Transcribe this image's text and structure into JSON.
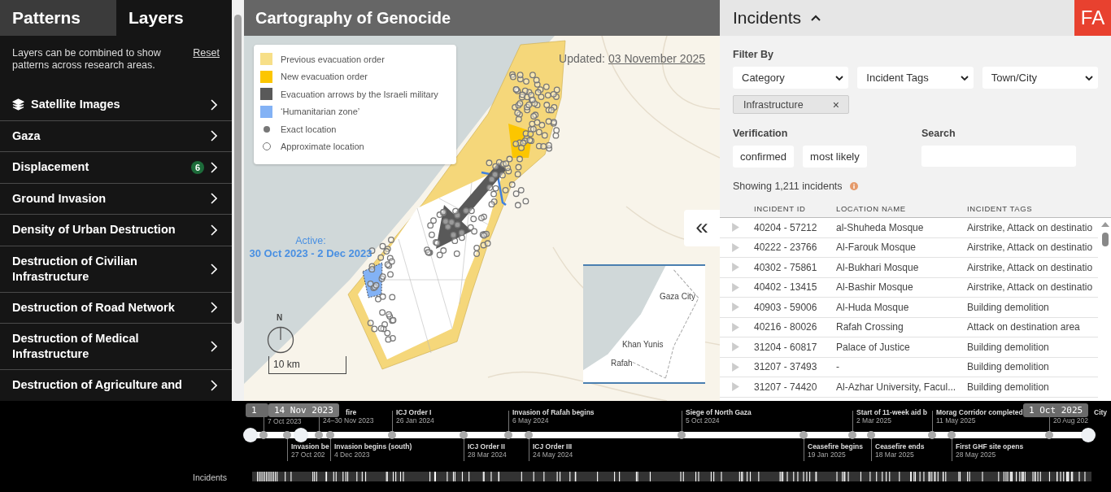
{
  "sidebar": {
    "tabs": [
      {
        "label": "Patterns",
        "selected": false
      },
      {
        "label": "Layers",
        "selected": true
      }
    ],
    "intro": "Layers can be combined to show patterns across research areas.",
    "reset": "Reset",
    "items": [
      {
        "label": "Satellite Images",
        "kind": "layers"
      },
      {
        "label": "Gaza",
        "kind": "plain"
      },
      {
        "label": "Displacement",
        "kind": "plain",
        "badge": "6"
      },
      {
        "label": "Ground Invasion",
        "kind": "plain"
      },
      {
        "label": "Density of Urban Destruction",
        "kind": "plain"
      },
      {
        "label": "Destruction of Civilian Infrastructure",
        "kind": "plain"
      },
      {
        "label": "Destruction of Road Network",
        "kind": "plain"
      },
      {
        "label": "Destruction of Medical Infrastructure",
        "kind": "plain"
      },
      {
        "label": "Destruction of Agriculture and",
        "kind": "plain"
      }
    ]
  },
  "map": {
    "title": "Cartography of Genocide",
    "legend": [
      {
        "label": "Previous evacuation order",
        "kind": "swatch",
        "color": "#f7df88"
      },
      {
        "label": "New evacuation order",
        "kind": "swatch",
        "color": "#fcc600"
      },
      {
        "label": "Evacuation arrows by the Israeli military",
        "kind": "swatch",
        "color": "#595959"
      },
      {
        "label": "‘Humanitarian zone’",
        "kind": "swatch",
        "color": "#83b2f5"
      },
      {
        "label": "Exact location",
        "kind": "dot",
        "color": "#777777"
      },
      {
        "label": "Approximate location",
        "kind": "ring",
        "color": "#777777"
      }
    ],
    "updated_label": "Updated:",
    "updated_date": "03 November 2025",
    "active_label": "Active:",
    "active_range": "30 Oct 2023 - 2 Dec 2023",
    "compass": "N",
    "scale": "10 km",
    "inset_places": [
      "Gaza City",
      "Khan Yunis",
      "Rafah"
    ],
    "collapse": "«"
  },
  "incidents": {
    "title": "Incidents",
    "expanded": true,
    "logo": "FA",
    "filter_label": "Filter By",
    "selects": [
      "Category",
      "Incident Tags",
      "Town/City"
    ],
    "chips": [
      "Infrastructure"
    ],
    "chip_remove": "×",
    "verification_label": "Verification",
    "verification": [
      "confirmed",
      "most likely"
    ],
    "search_label": "Search",
    "count": "Showing 1,211 incidents",
    "columns": [
      "INCIDENT ID",
      "LOCATION NAME",
      "INCIDENT TAGS"
    ],
    "rows": [
      {
        "id": "40204 - 57212",
        "location": "al-Shuheda Mosque",
        "tags": "Airstrike, Attack on destinatio"
      },
      {
        "id": "40222 - 23766",
        "location": "Al-Farouk Mosque",
        "tags": "Airstrike, Attack on destinatio"
      },
      {
        "id": "40302 - 75861",
        "location": "Al-Bukhari Mosque",
        "tags": "Airstrike, Attack on destinatio"
      },
      {
        "id": "40402 - 13415",
        "location": "Al-Bashir Mosque",
        "tags": "Airstrike, Attack on destinatio"
      },
      {
        "id": "40903 - 59006",
        "location": "Al-Huda Mosque",
        "tags": "Building demolition"
      },
      {
        "id": "40216 - 80026",
        "location": "Rafah Crossing",
        "tags": "Attack on destination area"
      },
      {
        "id": "31204 - 60817",
        "location": "Palace of Justice",
        "tags": "Building demolition"
      },
      {
        "id": "31207 - 37493",
        "location": "-",
        "tags": "Building demolition"
      },
      {
        "id": "31207 - 74420",
        "location": "Al-Azhar University, Facul...",
        "tags": "Building demolition"
      }
    ]
  },
  "timeline": {
    "handles": [
      {
        "tooltip": "1",
        "level": 0
      },
      {
        "tooltip": "14 Nov 2023",
        "level": 0.06
      },
      {
        "tooltip": "1 Oct 2025",
        "level": 1
      }
    ],
    "strip_label": "Incidents",
    "events": [
      {
        "date": "7 Oct 2023",
        "kind": "above"
      },
      {
        "label": "Invasion be",
        "date": "27 Oct 202",
        "kind": "below"
      },
      {
        "label": "fire",
        "date": "24–30 Nov 2023",
        "kind": "above"
      },
      {
        "label": "Invasion begins (south)",
        "date": "4 Dec 2023",
        "kind": "below"
      },
      {
        "label": "ICJ Order I",
        "date": "26 Jan 2024",
        "kind": "above"
      },
      {
        "label": "ICJ Order II",
        "date": "28 Mar 2024",
        "kind": "below"
      },
      {
        "label": "Invasion of Rafah begins",
        "date": "6 May 2024",
        "kind": "above"
      },
      {
        "label": "ICJ Order III",
        "date": "24 May 2024",
        "kind": "below"
      },
      {
        "label": "Siege of North Gaza",
        "date": "5 Oct 2024",
        "kind": "above"
      },
      {
        "label": "Ceasefire begins",
        "date": "19 Jan 2025",
        "kind": "below"
      },
      {
        "label": "Start of 11-week aid b",
        "date": "2 Mar 2025",
        "kind": "above"
      },
      {
        "label": "Ceasefire ends",
        "date": "18 Mar 2025",
        "kind": "below"
      },
      {
        "label": "Morag Corridor completed",
        "date": "11 May 2025",
        "kind": "above"
      },
      {
        "label": "First GHF site opens",
        "date": "28 May 2025",
        "kind": "below"
      },
      {
        "label": "City",
        "date": "20 Aug 202",
        "kind": "above"
      }
    ]
  }
}
